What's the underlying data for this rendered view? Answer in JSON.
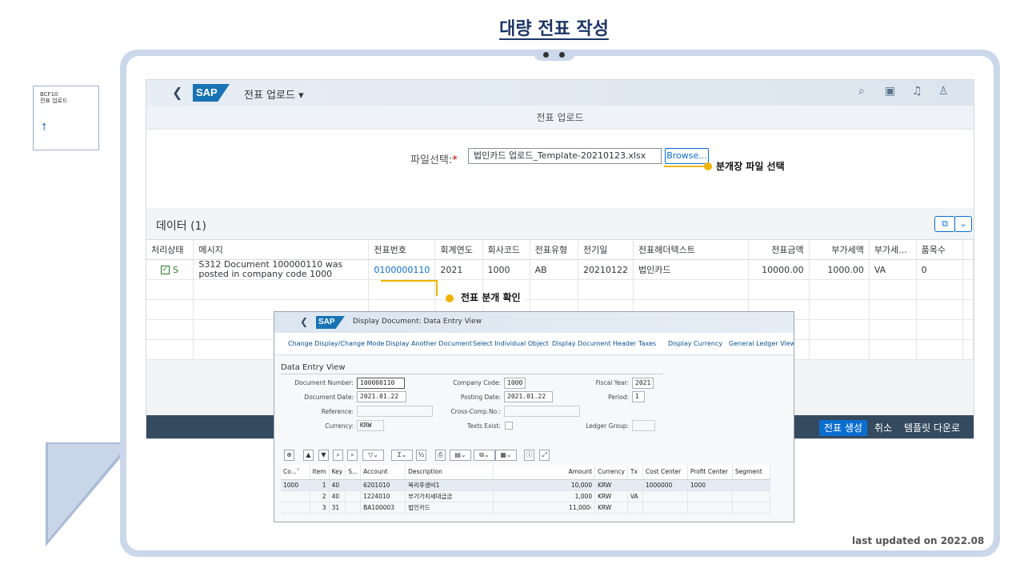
{
  "slide": {
    "title": "대량 전표 작성",
    "updated": "last updated on 2022.08"
  },
  "tile": {
    "line1": "BCF10",
    "line2": "전표 업로드",
    "icon": "upload-icon"
  },
  "shell": {
    "app_title": "전표 업로드 ▾",
    "logo": "SAP"
  },
  "page": {
    "subtitle": "전표 업로드",
    "file_label": "파일선택:",
    "required_mark": "*",
    "file_value": "법인카드 업로드_Template-20210123.xlsx",
    "browse_label": "Browse..."
  },
  "data_section": {
    "title": "데이터 (1)",
    "columns": [
      "처리상태",
      "메시지",
      "전표번호",
      "회계연도",
      "회사코드",
      "전표유형",
      "전기일",
      "전표헤더텍스트",
      "전표금액",
      "부가세액",
      "부가세...",
      "품목수"
    ],
    "rows": [
      {
        "status": "S",
        "message": "S312 Document 100000110 was posted in company code 1000",
        "doc_no": "0100000110",
        "fiscal_year": "2021",
        "company_code": "1000",
        "doc_type": "AB",
        "posting_date": "20210122",
        "header_text": "법인카드",
        "amount": "10000.00",
        "vat_amount": "1000.00",
        "vat_code": "VA",
        "item_count": "0"
      }
    ]
  },
  "footer": {
    "create": "전표 생성",
    "cancel": "취소",
    "template_download": "템플릿 다운로드"
  },
  "callouts": {
    "browse": "분개장 파일 선택",
    "doc": "전표 분개 확인"
  },
  "gui": {
    "title": "Display Document: Data Entry View",
    "logo": "SAP",
    "menu": [
      "Change Display/Change Mode",
      "Display Another Document",
      "Select Individual Object",
      "Display Document Header",
      "Taxes",
      "Display Currency",
      "General Ledger View"
    ],
    "section_title": "Data Entry View",
    "labels": {
      "document_number": "Document Number:",
      "company_code": "Company Code:",
      "fiscal_year": "Fiscal Year:",
      "document_date": "Document Date:",
      "posting_date": "Posting Date:",
      "period": "Period:",
      "reference": "Reference:",
      "cross_comp": "Cross-Comp.No.:",
      "currency": "Currency:",
      "texts_exist": "Texts Exist:",
      "ledger_group": "Ledger Group:"
    },
    "values": {
      "document_number": "100000110",
      "company_code": "1000",
      "fiscal_year": "2021",
      "document_date": "2021.01.22",
      "posting_date": "2021.01.22",
      "period": "1",
      "reference": "",
      "cross_comp": "",
      "currency": "KRW",
      "ledger_group": ""
    },
    "table": {
      "columns": [
        "Co...",
        "Item",
        "Key",
        "S...",
        "Account",
        "Description",
        "Amount",
        "Currency",
        "Tx",
        "Cost Center",
        "Profit Center",
        "Segment"
      ],
      "rows": [
        [
          "1000",
          "1",
          "40",
          "",
          "6201010",
          "복리후생비1",
          "10,000",
          "KRW",
          "",
          "1000000",
          "1000",
          ""
        ],
        [
          "",
          "2",
          "40",
          "",
          "1224010",
          "부가가치세대급금",
          "1,000",
          "KRW",
          "VA",
          "",
          "",
          ""
        ],
        [
          "",
          "3",
          "31",
          "",
          "BA100003",
          "법인카드",
          "11,000-",
          "KRW",
          "",
          "",
          "",
          ""
        ]
      ]
    }
  },
  "colors": {
    "accent": "#0a6ed1",
    "shell_footer": "#354a5f",
    "callout": "#f0b400",
    "frame": "#cbd7ea",
    "success": "#2b7c2b"
  }
}
